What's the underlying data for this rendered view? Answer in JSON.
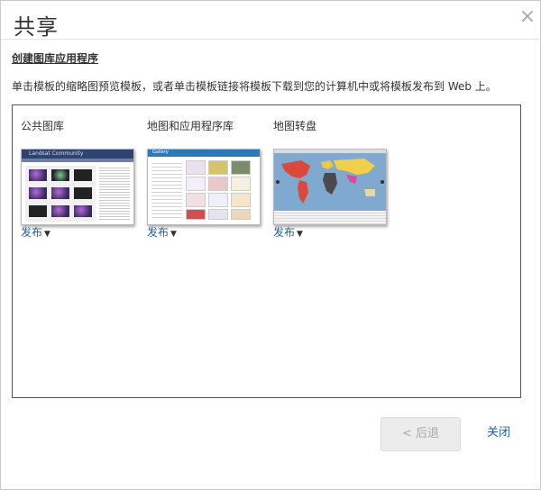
{
  "dialog": {
    "title": "共享",
    "close_icon": "×"
  },
  "section": {
    "heading": "创建图库应用程序",
    "instructions": "单击模板的缩略图预览模板，或者单击模板链接将模板下载到您的计算机中或将模板发布到 Web 上。"
  },
  "templates": [
    {
      "name": "公共图库",
      "thumbnail_caption": "Landsat Community",
      "publish_label": "发布",
      "caret": "▼"
    },
    {
      "name": "地图和应用程序库",
      "thumbnail_caption": "Gallery",
      "publish_label": "发布",
      "caret": "▼"
    },
    {
      "name": "地图转盘",
      "publish_label": "发布",
      "caret": "▼"
    }
  ],
  "footer": {
    "back_label": "< 后退",
    "close_label": "关闭"
  },
  "colors": {
    "link": "#1a63a8",
    "disabled_button_bg": "#ececec"
  }
}
